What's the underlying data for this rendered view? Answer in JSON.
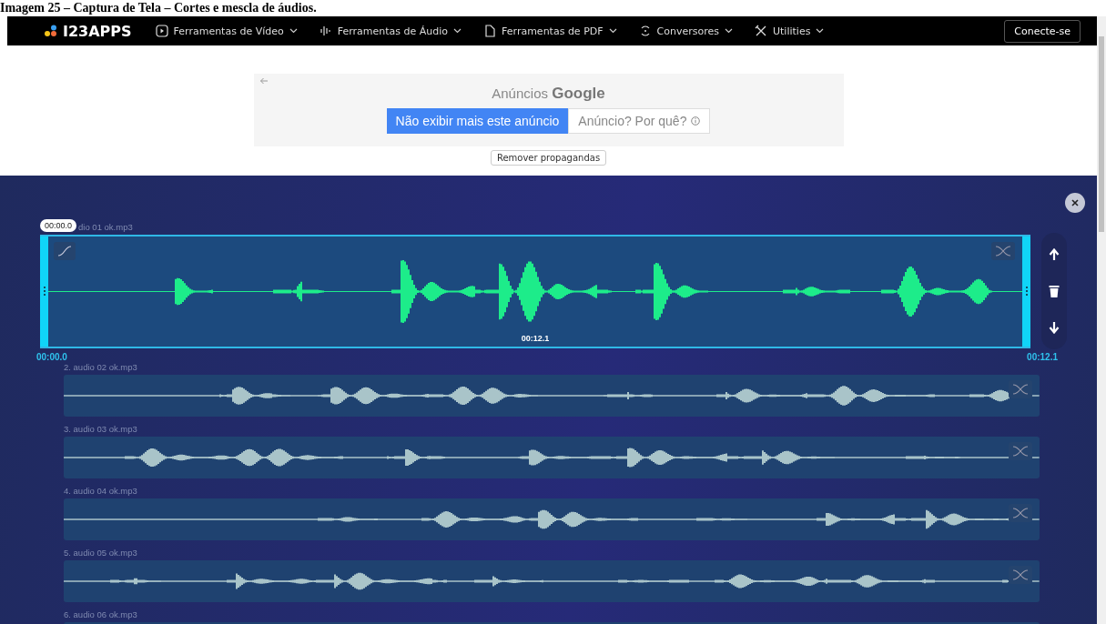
{
  "caption": "Imagem 25 – Captura de Tela – Cortes e mescla de áudios.",
  "navbar": {
    "logo": "I23APPS",
    "menus": [
      {
        "label": "Ferramentas de Vídeo",
        "kind": "video"
      },
      {
        "label": "Ferramentas de Áudio",
        "kind": "audio"
      },
      {
        "label": "Ferramentas de PDF",
        "kind": "pdf"
      },
      {
        "label": "Conversores",
        "kind": "convert"
      },
      {
        "label": "Utilities",
        "kind": "tools"
      }
    ],
    "login_button": "Conecte-se"
  },
  "ad": {
    "title_prefix": "Anúncios",
    "title_brand": "Google",
    "hide_button": "Não exibir mais este anúncio",
    "why_button": "Anúncio? Por quê?",
    "remove_button": "Remover propagandas"
  },
  "editor": {
    "cursor_time": "00:00.0",
    "start_time": "00:00.0",
    "end_time": "00:12.1",
    "tracks": [
      {
        "name": "dio 01 ok.mp3",
        "selected": true,
        "duration": "00:12.1"
      },
      {
        "name": "2. audio 02 ok.mp3",
        "selected": false
      },
      {
        "name": "3. audio 03 ok.mp3",
        "selected": false
      },
      {
        "name": "4. audio 04 ok.mp3",
        "selected": false
      },
      {
        "name": "5. audio 05 ok.mp3",
        "selected": false
      },
      {
        "name": "6. audio 06 ok.mp3",
        "selected": false
      }
    ]
  }
}
